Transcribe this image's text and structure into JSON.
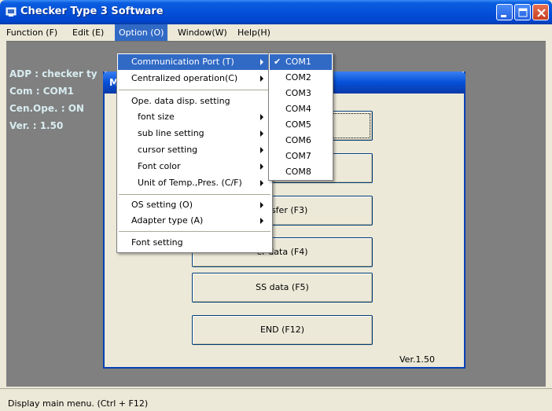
{
  "window": {
    "title": "Checker Type 3 Software"
  },
  "menubar": [
    {
      "label": "Function (F)"
    },
    {
      "label": "Edit (E)"
    },
    {
      "label": "Option (O)"
    },
    {
      "label": "Window(W)"
    },
    {
      "label": "Help(H)"
    }
  ],
  "info": {
    "adp": "ADP : checker ty",
    "com": "Com : COM1",
    "cen": "Cen.Ope. : ON",
    "ver": "Ver. : 1.50"
  },
  "child": {
    "title": "M",
    "buttons": [
      {
        "label": ""
      },
      {
        "label": ""
      },
      {
        "label": "ransfer (F3)"
      },
      {
        "label": "er data (F4)"
      },
      {
        "label": "SS data (F5)"
      },
      {
        "label": "END (F12)"
      }
    ],
    "version": "Ver.1.50"
  },
  "option_menu": {
    "items": [
      "Communication Port (T)",
      "Centralized operation(C)",
      "Ope. data disp. setting",
      "font size",
      "sub line setting",
      "cursor setting",
      "Font color",
      "Unit of Temp.,Pres. (C/F)",
      "OS setting (O)",
      "Adapter type (A)",
      "Font setting"
    ],
    "check_mark": "✔"
  },
  "port_menu": {
    "items": [
      "COM1",
      "COM2",
      "COM3",
      "COM4",
      "COM5",
      "COM6",
      "COM7",
      "COM8"
    ],
    "selected": "COM1"
  },
  "status": {
    "text": "Display main menu. (Ctrl + F12)"
  },
  "colors": {
    "titlebar": "#0550d8",
    "highlight": "#316ac5",
    "mdi_background": "#808080",
    "info_text": "#d8ecf0"
  }
}
